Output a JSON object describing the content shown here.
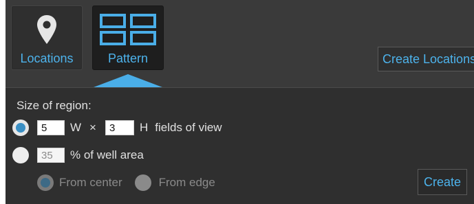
{
  "toolbar": {
    "locations_label": "Locations",
    "pattern_label": "Pattern",
    "create_locations_label": "Create Locations",
    "active_tab": "pattern"
  },
  "panel": {
    "size_label": "Size of region:",
    "fields_option": {
      "selected": true,
      "width_value": "5",
      "w_label": "W",
      "times": "×",
      "height_value": "3",
      "h_label": "H",
      "suffix": "fields of view"
    },
    "area_option": {
      "selected": false,
      "percent_value": "35",
      "suffix": "% of well area"
    },
    "origin": {
      "from_center_label": "From center",
      "from_edge_label": "From edge",
      "selected": "from_center",
      "enabled": false
    },
    "create_label": "Create"
  },
  "colors": {
    "accent": "#4db3ec",
    "background": "#3a3a3a",
    "panel": "#2f2f2f",
    "text": "#e0e0e0",
    "disabled_text": "#8a8a8a"
  },
  "icons": {
    "locations": "map-pin-icon",
    "pattern": "grid-pattern-icon"
  }
}
